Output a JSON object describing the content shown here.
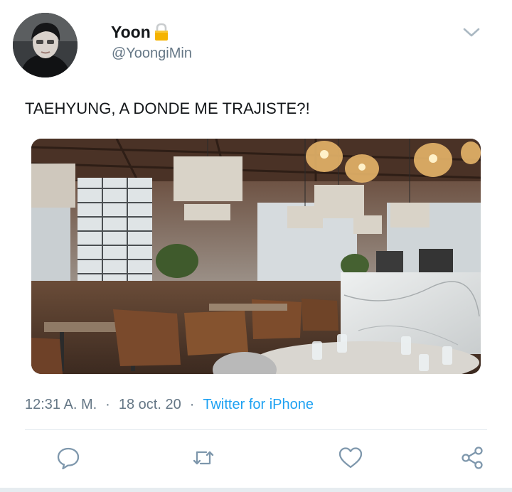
{
  "user": {
    "display_name": "Yoon",
    "handle": "@YoongiMin",
    "protected_icon": "lock-icon",
    "avatar": "avatar-photo"
  },
  "tweet": {
    "text": "TAEHYUNG, A DONDE ME TRAJISTE?!",
    "media": "restaurant-interior-photo",
    "time": "12:31 A. M.",
    "separator": "·",
    "date": "18 oct. 20",
    "source": "Twitter for iPhone"
  },
  "actions": {
    "reply": "reply-icon",
    "retweet": "retweet-icon",
    "like": "heart-icon",
    "share": "share-icon"
  },
  "colors": {
    "text": "#14171a",
    "secondary": "#657786",
    "link": "#1da1f2",
    "lock": "#f5b301",
    "divider": "#e1e8ed"
  }
}
